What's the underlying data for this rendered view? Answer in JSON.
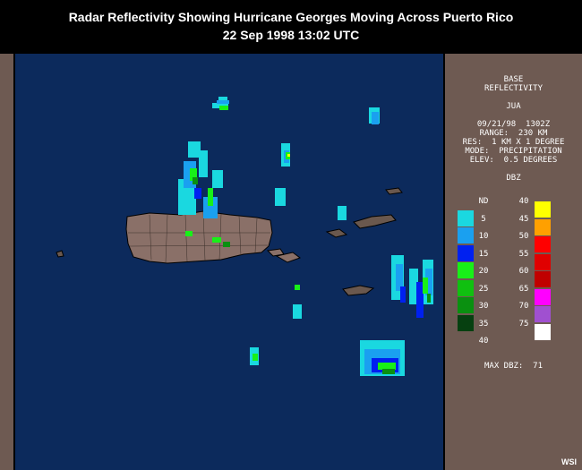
{
  "title": {
    "line1": "Radar Reflectivity Showing Hurricane Georges Moving Across Puerto Rico",
    "line2": "22 Sep 1998 13:02 UTC"
  },
  "panel": {
    "product_line1": "BASE",
    "product_line2": "REFLECTIVITY",
    "station": "JUA",
    "datetime": "09/21/98  1302Z",
    "range": "RANGE:  230 KM",
    "res": "RES:  1 KM X 1 DEGREE",
    "mode": "MODE:  PRECIPITATION",
    "elev": "ELEV:  0.5 DEGREES",
    "dbz_header": "DBZ",
    "max_dbz": "MAX DBZ:  71"
  },
  "legend_left": [
    {
      "label": "ND",
      "color": null
    },
    {
      "label": "5",
      "color": "#1ad8e0"
    },
    {
      "label": "10",
      "color": "#1aa0f0"
    },
    {
      "label": "15",
      "color": "#0020f0"
    },
    {
      "label": "20",
      "color": "#18f018"
    },
    {
      "label": "25",
      "color": "#10c010"
    },
    {
      "label": "30",
      "color": "#0a9010"
    },
    {
      "label": "35",
      "color": "#064010"
    },
    {
      "label": "40",
      "color": null
    }
  ],
  "legend_right": [
    {
      "label": "40",
      "color": "#ffff00"
    },
    {
      "label": "45",
      "color": "#ffa000"
    },
    {
      "label": "50",
      "color": "#ff0000"
    },
    {
      "label": "55",
      "color": "#e00000"
    },
    {
      "label": "60",
      "color": "#c00000"
    },
    {
      "label": "65",
      "color": "#ff00ff"
    },
    {
      "label": "70",
      "color": "#a050d0"
    },
    {
      "label": "75",
      "color": "#ffffff"
    }
  ],
  "map": {
    "ocean_color": "#0c2a5c",
    "land_color": "#8a7068"
  },
  "credit": "WSI"
}
